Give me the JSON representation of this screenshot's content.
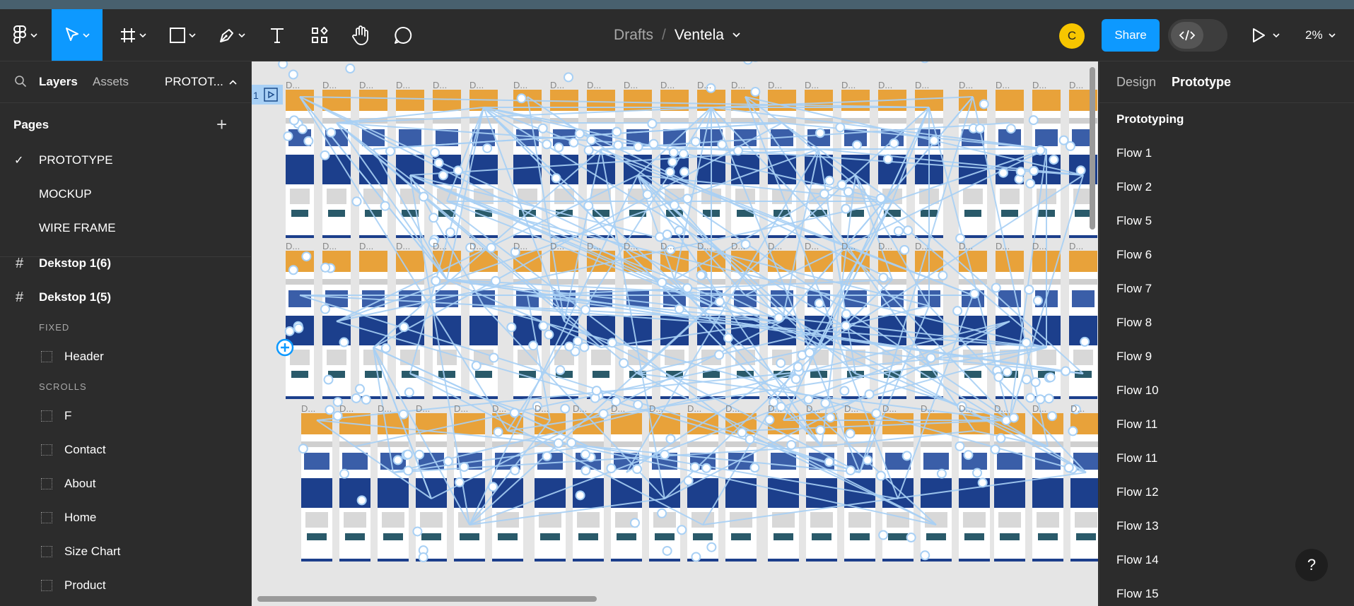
{
  "colors": {
    "accent": "#0d99ff",
    "avatar": "#f7c600",
    "flow_line": "#a8d0f5",
    "frame_dark": "#1c3f8c"
  },
  "toolbar": {
    "tools": [
      {
        "name": "figma-menu-icon"
      },
      {
        "name": "move-tool-icon"
      },
      {
        "name": "frame-tool-icon"
      },
      {
        "name": "rectangle-tool-icon"
      },
      {
        "name": "pen-tool-icon"
      },
      {
        "name": "text-tool-icon"
      },
      {
        "name": "resources-icon"
      },
      {
        "name": "hand-tool-icon"
      },
      {
        "name": "comment-icon"
      }
    ],
    "breadcrumb_drafts": "Drafts",
    "separator": "/",
    "file_name": "Ventela",
    "avatar_initial": "C",
    "share_label": "Share",
    "zoom_level": "2%"
  },
  "left_panel": {
    "tabs": {
      "layers": "Layers",
      "assets": "Assets",
      "page": "PROTOT..."
    },
    "pages_heading": "Pages",
    "pages": [
      "PROTOTYPE",
      "MOCKUP",
      "WIRE FRAME"
    ],
    "layers": {
      "frame1": "Dekstop 1(6)",
      "frame2": "Dekstop 1(5)",
      "fixed": "FIXED",
      "header": "Header",
      "scrolls": "SCROLLS",
      "children": [
        "F",
        "Contact",
        "About",
        "Home",
        "Size Chart",
        "Product"
      ]
    }
  },
  "canvas": {
    "frame_number": "1",
    "frame_label": "D..."
  },
  "right_panel": {
    "tabs": {
      "design": "Design",
      "prototype": "Prototype"
    },
    "heading": "Prototyping",
    "flows": [
      "Flow 1",
      "Flow 2",
      "Flow 5",
      "Flow 6",
      "Flow 7",
      "Flow 8",
      "Flow 9",
      "Flow 10",
      "Flow 11",
      "Flow 11",
      "Flow 12",
      "Flow 13",
      "Flow 14",
      "Flow 15"
    ]
  },
  "help_label": "?"
}
